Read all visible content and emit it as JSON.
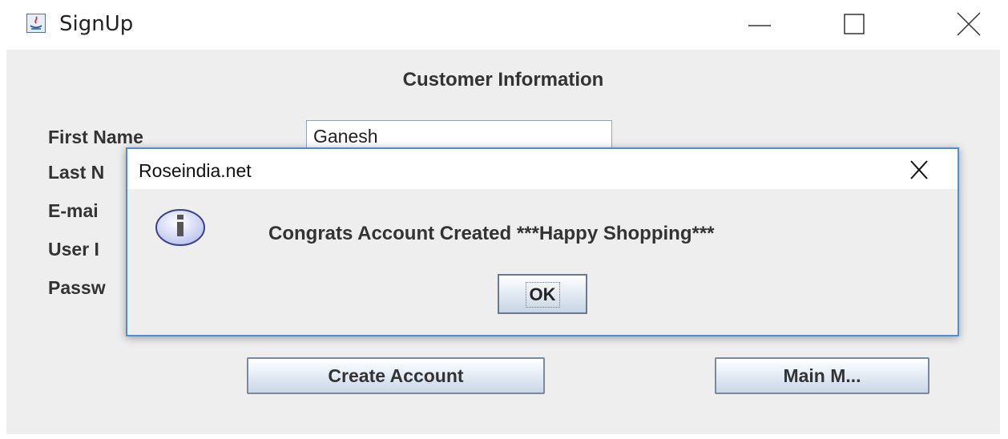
{
  "window": {
    "title": "SignUp",
    "icon": "java-app-icon",
    "controls": [
      "minimize-icon",
      "maximize-icon",
      "close-icon"
    ]
  },
  "form": {
    "heading": "Customer Information",
    "labels": {
      "first_name": "First Name",
      "last_name": "Last N",
      "email": "E-mai",
      "user": "User I",
      "password": "Passw"
    },
    "first_name_value": "Ganesh",
    "create_button": "Create Account",
    "main_menu_button": "Main M..."
  },
  "dialog": {
    "title": "Roseindia.net",
    "message": "Congrats Account Created ***Happy Shopping***",
    "ok_label": "OK",
    "icon": "info-icon",
    "accent": "#4a8fd8"
  },
  "colors": {
    "panel_bg": "#eeeeee",
    "titlebar_bg": "#ffffff",
    "dialog_border": "#4a8fd8"
  }
}
